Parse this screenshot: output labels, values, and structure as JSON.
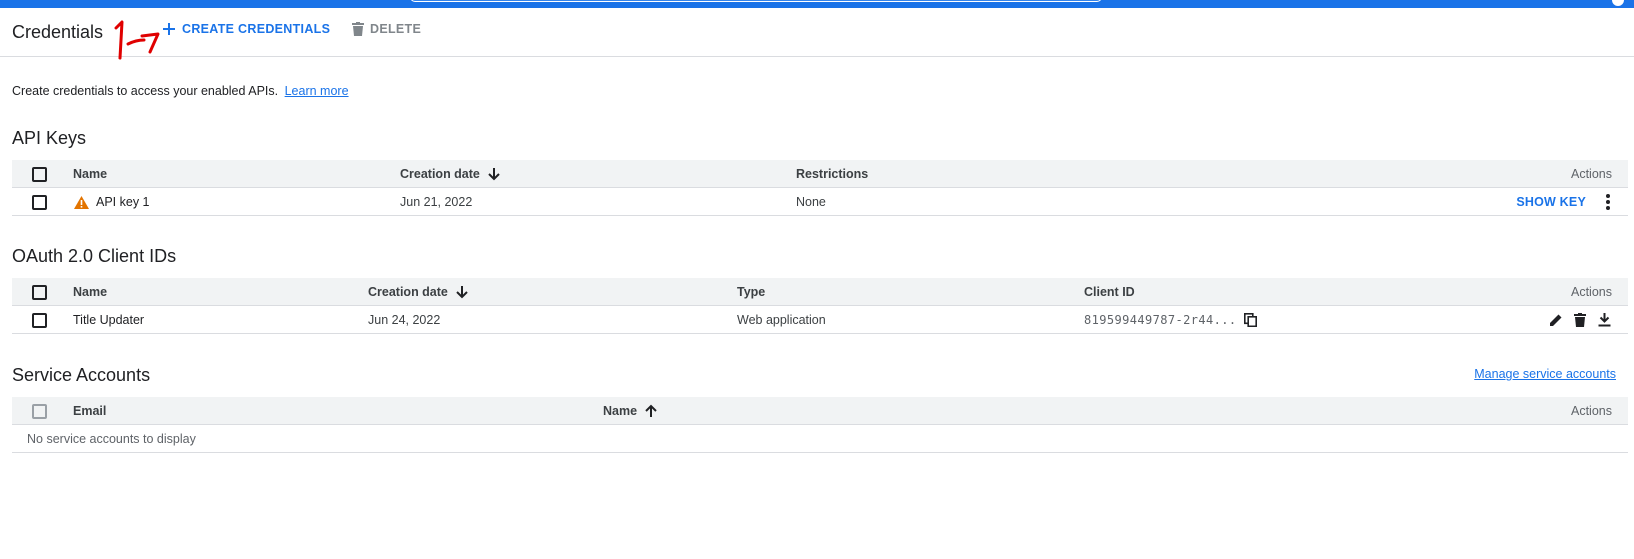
{
  "header": {
    "title": "Credentials",
    "create_label": "CREATE CREDENTIALS",
    "delete_label": "DELETE"
  },
  "intro": {
    "text": "Create credentials to access your enabled APIs.",
    "learn_more": "Learn more"
  },
  "api_keys": {
    "title": "API Keys",
    "columns": {
      "name": "Name",
      "creation_date": "Creation date",
      "restrictions": "Restrictions",
      "actions": "Actions"
    },
    "rows": [
      {
        "name": "API key 1",
        "creation_date": "Jun 21, 2022",
        "restrictions": "None",
        "action_label": "SHOW KEY"
      }
    ]
  },
  "oauth": {
    "title": "OAuth 2.0 Client IDs",
    "columns": {
      "name": "Name",
      "creation_date": "Creation date",
      "type": "Type",
      "client_id": "Client ID",
      "actions": "Actions"
    },
    "rows": [
      {
        "name": "Title Updater",
        "creation_date": "Jun 24, 2022",
        "type": "Web application",
        "client_id": "819599449787-2r44..."
      }
    ]
  },
  "service_accounts": {
    "title": "Service Accounts",
    "manage_link": "Manage service accounts",
    "columns": {
      "email": "Email",
      "name": "Name",
      "actions": "Actions"
    },
    "empty_text": "No service accounts to display"
  },
  "colors": {
    "accent": "#1a73e8",
    "warning": "#e37400",
    "annotation": "#e00000"
  }
}
